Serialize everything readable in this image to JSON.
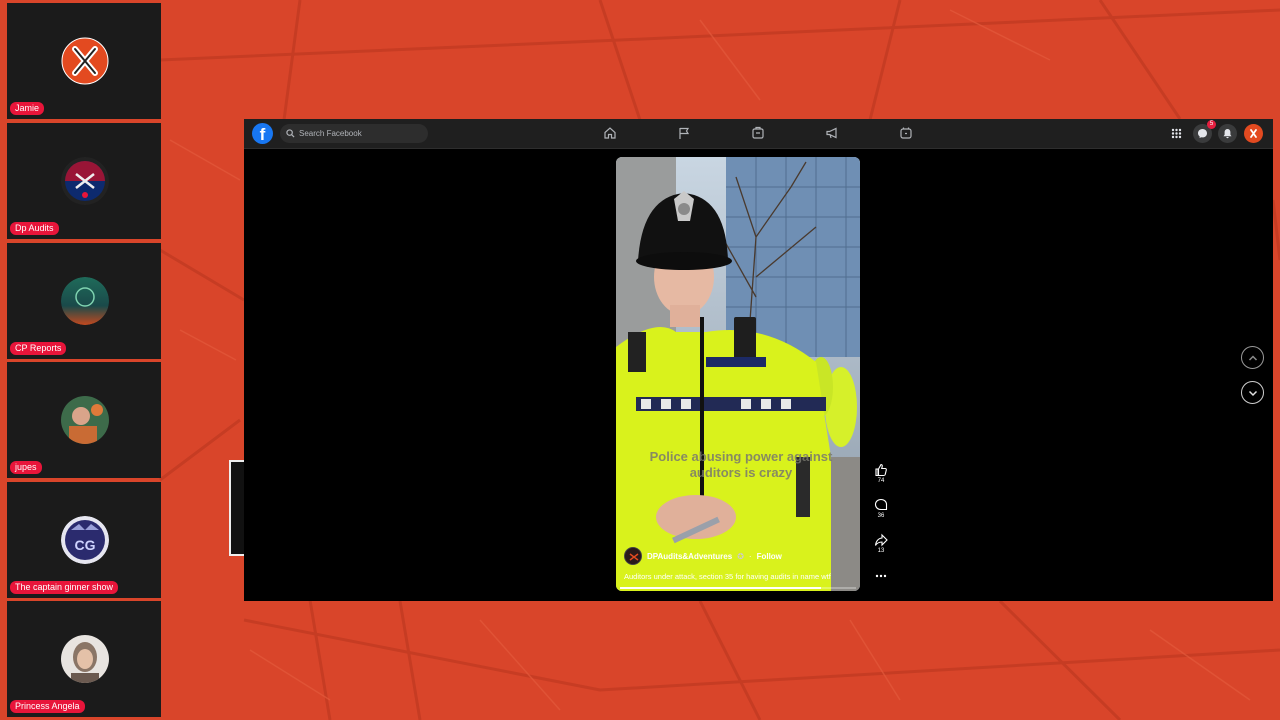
{
  "participants": [
    {
      "name": "Jamie",
      "avatar_icon": "x-logo-avatar-icon"
    },
    {
      "name": "Dp Audits",
      "avatar_icon": "dp-audits-logo-icon"
    },
    {
      "name": "CP Reports",
      "avatar_icon": "cp-reports-logo-icon"
    },
    {
      "name": "jupes",
      "avatar_icon": "user-photo-avatar-icon"
    },
    {
      "name": "The captain ginner show",
      "avatar_icon": "cg-logo-avatar-icon"
    },
    {
      "name": "Princess Angela",
      "avatar_icon": "user-photo-avatar-icon"
    }
  ],
  "facebook": {
    "search_placeholder": "Search Facebook",
    "nav_icons": [
      "home-icon",
      "flag-icon",
      "marketplace-icon",
      "megaphone-icon",
      "gaming-icon"
    ],
    "right_icons": [
      "menu-grid-icon",
      "messenger-icon",
      "bell-icon",
      "profile-avatar-icon"
    ],
    "messenger_badge": "5",
    "accent": "#1877f2"
  },
  "reel": {
    "overlay_text": "Police abusing power against auditors is crazy",
    "author": "DPAudits&Adventures",
    "follow_label": "Follow",
    "separator": "·",
    "description": "Auditors under attack, section 35 for having audits in name wtf",
    "progress": 0.85,
    "likes": "74",
    "comments": "36",
    "shares": "13"
  },
  "colors": {
    "background": "#d9452a",
    "name_tag": "#e8153a",
    "tile": "#1b1b1b"
  }
}
